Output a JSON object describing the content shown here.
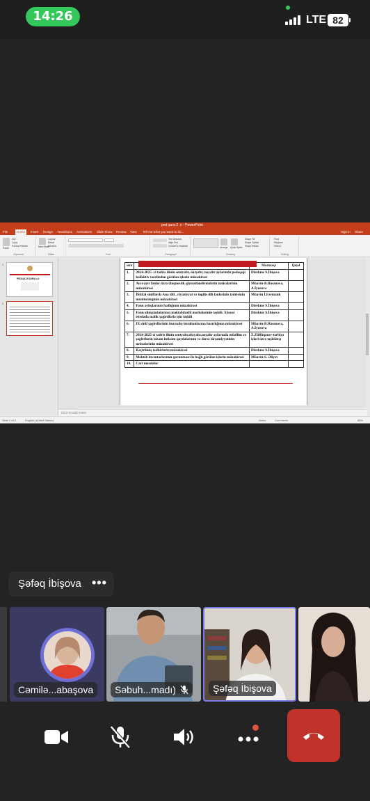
{
  "status_bar": {
    "time": "14:26",
    "network": "LTE",
    "battery": "82"
  },
  "shared_screen": {
    "window_title": "ped-şura-2 .n  -  PowerPoint",
    "tabs": [
      "File",
      "Home",
      "Insert",
      "Design",
      "Transitions",
      "Animations",
      "Slide Show",
      "Review",
      "View"
    ],
    "tell_me": "Tell me what you want to do...",
    "sign_in": "Sign in",
    "share": "Share",
    "ribbon_groups": [
      "Clipboard",
      "Slides",
      "Font",
      "Paragraph",
      "Drawing",
      "Editing"
    ],
    "ribbon_buttons": {
      "paste": "Paste",
      "cut": "Cut",
      "copy": "Copy",
      "format_painter": "Format Painter",
      "new_slide": "New Slide",
      "layout": "Layout",
      "reset": "Reset",
      "section": "Section",
      "text_direction": "Text Direction",
      "align_text": "Align Text",
      "convert_smartart": "Convert to SmartArt",
      "arrange": "Arrange",
      "quick_styles": "Quick Styles",
      "shape_fill": "Shape Fill",
      "shape_outline": "Shape Outline",
      "shape_effects": "Shape Effects",
      "find": "Find",
      "replace": "Replace",
      "select": "Select"
    },
    "thumbnails": [
      {
        "num": "1",
        "line1": "PEDAQOJİ ŞURA №2"
      },
      {
        "num": "2",
        "line1": ""
      }
    ],
    "notes_placeholder": "Click to add notes",
    "status_left": "Slide 2 of 2",
    "status_lang": "English (United States)",
    "status_notes": "Notes",
    "status_comments": "Comments",
    "status_zoom": "85%"
  },
  "slide_table": {
    "headers": [
      "sıra",
      "Müzakirə olunacaq məsələ",
      "Məruzəçi",
      "Qeyd"
    ],
    "rows": [
      {
        "n": "1.",
        "topic": "2024-2025 -ci tədris ilinin sentyabr, oktyabr, noyabr aylarında pedaqoji kollektiv tərəfindən görülən işlərin  müzakirəsi",
        "speaker": "Direktor S.İbişova"
      },
      {
        "n": "2.",
        "topic": "Ayrı-ayrı  fənlər  üzrə diaqnostik qiymətləndirmələrin nəticələrinin müzakirəsi",
        "speaker": "Müavin-B.Həsənova, A.İyusova"
      },
      {
        "n": "3.",
        "topic": "İbtidai siniflərdə  Ana dili , riyaziyyat və ingilis dili fənlərinin tədrisinin monitorinqinin müzakirəsi",
        "speaker": "Müavin  İ.Fərmanlı"
      },
      {
        "n": "4.",
        "topic": "Fənn aylıqlarının fəallığının  müzakirəsi",
        "speaker": "Direktor S.İbişova"
      },
      {
        "n": "5.",
        "topic": "Fənn olimpiadalarının məktəbdaxili mərhələsinin təşkili. Xüsusi istedada malik şagirdlərlə işin təşkili",
        "speaker": "Direktor S.İbişova"
      },
      {
        "n": "6.",
        "topic": "IX sinif şagirdlərinin buraxılış imtahanlarına hazırlığının müzakirəsi",
        "speaker": "Müavin-B.Həsənova, A.İyusova"
      },
      {
        "n": "7.",
        "topic": "2024-2025-ci tədris ilinin sentyabr,oktyabr,noyabr  aylarında müəllim və şagirdlərin nizam intizam qaydalarının  və dərsə davamiyyətinin nəticələrinin  müzakirəsi",
        "speaker": "Z.Zülfüqarov-tərbiyə işləri üzrə təşkilatçı"
      },
      {
        "n": "8.",
        "topic": "Keçirilmiş  tədbirlərin  müzakirəsi",
        "speaker": "Direktor S.İbişova"
      },
      {
        "n": "9.",
        "topic": "Məktəb  inventarlarının qorunması ilə bağlı   görülən işlərin müzakirəsi",
        "speaker": "Müavin-S. Əliyev"
      },
      {
        "n": "10.",
        "topic": "Cari məsələlər",
        "speaker": ""
      }
    ]
  },
  "active_speaker": {
    "name": "Şəfəq İbişova",
    "more": "•••"
  },
  "participants": [
    {
      "name": "Cəmilə...abaşova",
      "muted": false
    },
    {
      "name": "Səbuh...madı)",
      "muted": true
    },
    {
      "name": "Şəfəq İbişova",
      "muted": false
    },
    {
      "name": "",
      "muted": false
    }
  ],
  "controls": {
    "video_icon": "video-camera-icon",
    "mic_icon": "mic-muted-icon",
    "speaker_icon": "speaker-icon",
    "more_icon": "more-icon",
    "end_icon": "end-call-icon"
  },
  "colors": {
    "ppt_red": "#c43e1c",
    "end_call": "#c0322a",
    "active_border": "#7b7bf0",
    "time_pill": "#34c759"
  }
}
